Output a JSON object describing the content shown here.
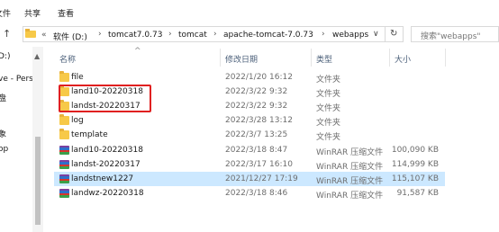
{
  "ribbon": {
    "tabs": [
      "文件",
      "共享",
      "查看"
    ]
  },
  "address": {
    "root_chevron": "«",
    "segments": [
      "软件 (D:)",
      "tomcat7.0.73",
      "tomcat",
      "apache-tomcat-7.0.73",
      "webapps"
    ],
    "separator": "›",
    "dropdown_glyph": "∨",
    "refresh_glyph": "↻"
  },
  "search": {
    "placeholder": "搜索\"webapps\""
  },
  "nav": {
    "items": [
      "D:)",
      "ve - Perso",
      "盘",
      "象",
      "op"
    ]
  },
  "columns": {
    "name": "名称",
    "date": "修改日期",
    "type": "类型",
    "size": "大小",
    "sort_glyph": "^"
  },
  "files": [
    {
      "name": "file",
      "date": "2022/1/20 16:12",
      "type": "文件夹",
      "size": "",
      "icon": "folder-icon"
    },
    {
      "name": "land10-20220318",
      "date": "2022/3/22 9:32",
      "type": "文件夹",
      "size": "",
      "icon": "folder-icon"
    },
    {
      "name": "landst-20220317",
      "date": "2022/3/22 9:32",
      "type": "文件夹",
      "size": "",
      "icon": "folder-icon"
    },
    {
      "name": "log",
      "date": "2022/3/28 13:12",
      "type": "文件夹",
      "size": "",
      "icon": "folder-icon"
    },
    {
      "name": "template",
      "date": "2022/3/7 13:25",
      "type": "文件夹",
      "size": "",
      "icon": "folder-icon"
    },
    {
      "name": "land10-20220318",
      "date": "2022/3/18 8:47",
      "type": "WinRAR 压缩文件",
      "size": "100,090 KB",
      "icon": "winrar-icon"
    },
    {
      "name": "landst-20220317",
      "date": "2022/3/17 16:10",
      "type": "WinRAR 压缩文件",
      "size": "114,999 KB",
      "icon": "winrar-icon"
    },
    {
      "name": "landstnew1227",
      "date": "2021/12/27 17:19",
      "type": "WinRAR 压缩文件",
      "size": "115,107 KB",
      "icon": "winrar-icon",
      "selected": true
    },
    {
      "name": "landwz-20220318",
      "date": "2022/3/18 8:46",
      "type": "WinRAR 压缩文件",
      "size": "91,587 KB",
      "icon": "winrar-icon"
    }
  ],
  "colors": {
    "folder": "#f7c948",
    "selection": "#cce8ff",
    "highlight_box": "#e02020",
    "header_text": "#4c607a"
  }
}
